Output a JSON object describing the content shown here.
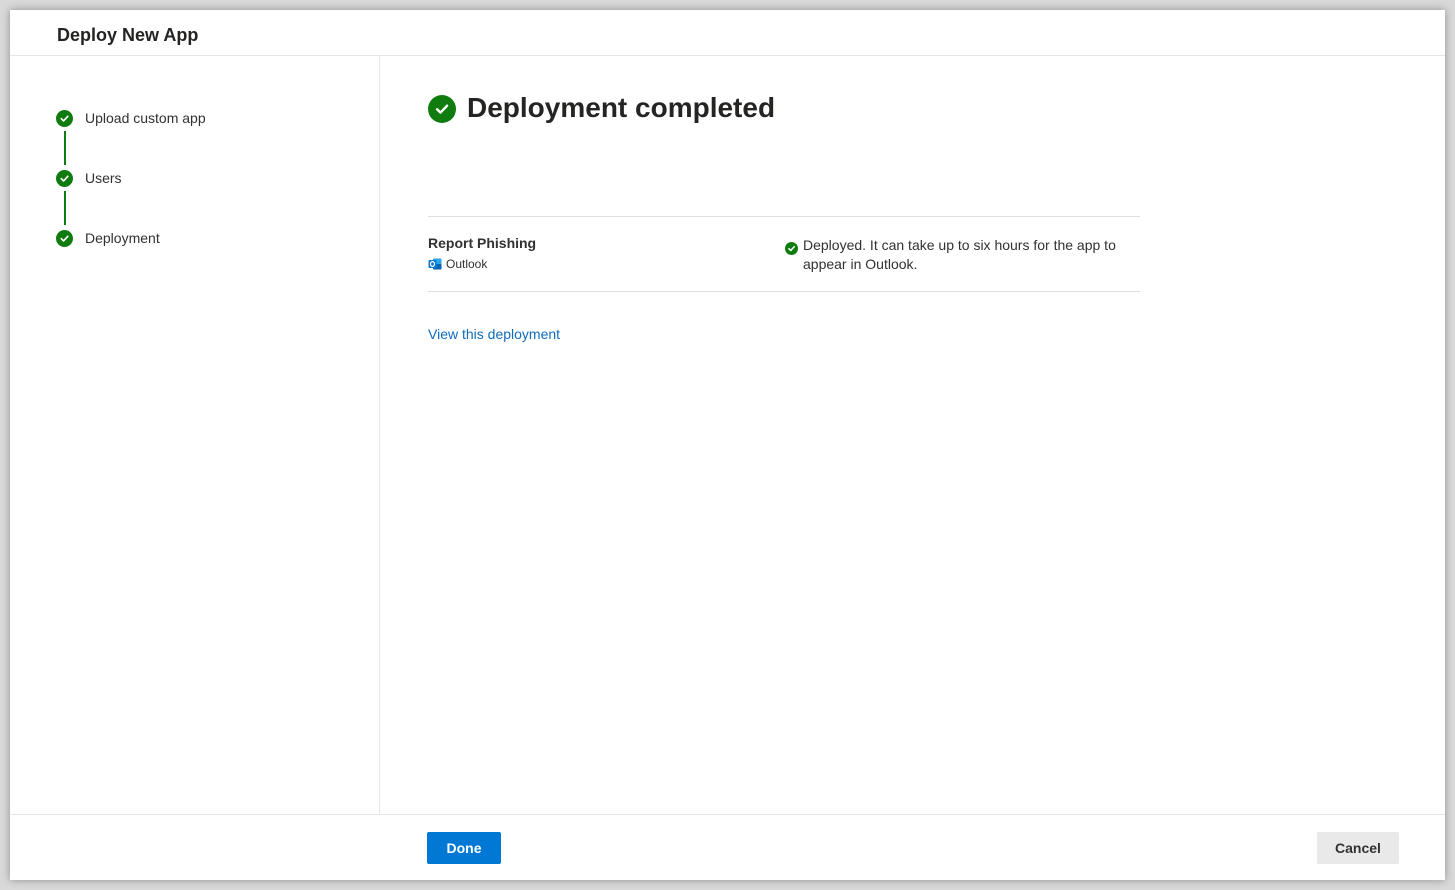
{
  "dialog": {
    "title": "Deploy New App"
  },
  "steps": [
    {
      "label": "Upload custom app",
      "status": "completed",
      "icon": "check-circle-icon"
    },
    {
      "label": "Users",
      "status": "completed",
      "icon": "check-circle-icon"
    },
    {
      "label": "Deployment",
      "status": "completed",
      "icon": "check-circle-icon"
    }
  ],
  "main": {
    "heading": "Deployment completed",
    "heading_icon": "check-circle-icon",
    "result": {
      "app_name": "Report Phishing",
      "host_icon": "outlook-icon",
      "host": "Outlook",
      "status_icon": "check-circle-icon",
      "status_text": "Deployed. It can take up to six hours for the app to appear in Outlook."
    },
    "view_link": "View this deployment"
  },
  "footer": {
    "done_label": "Done",
    "cancel_label": "Cancel"
  },
  "colors": {
    "success": "#107c10",
    "primary": "#0078d4",
    "link": "#0f6cbd",
    "secondary_button": "#e9e9e9"
  }
}
